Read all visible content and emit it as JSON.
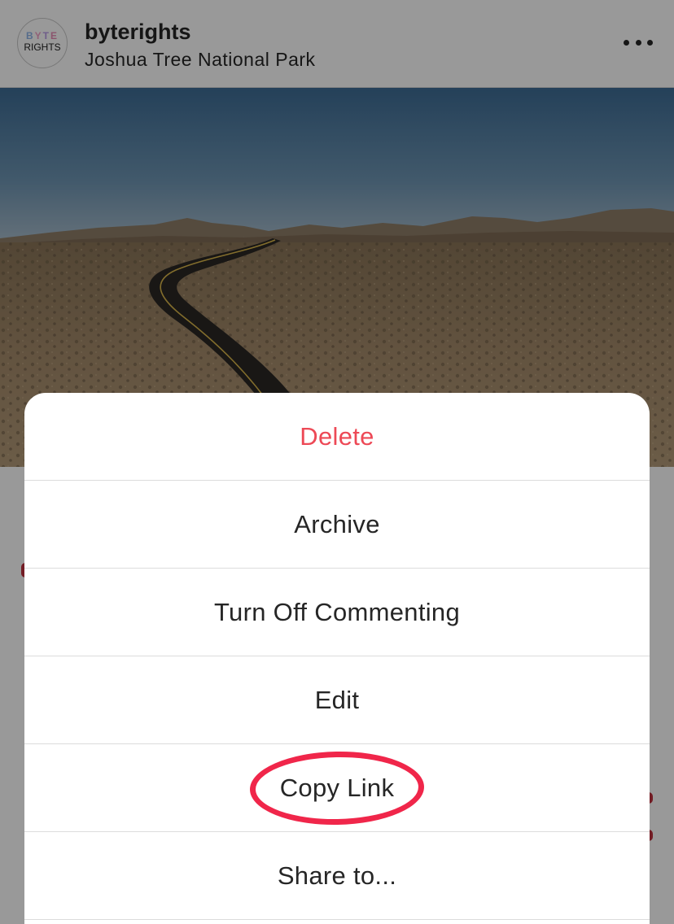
{
  "post": {
    "username": "byterights",
    "location": "Joshua Tree National Park",
    "avatar": {
      "top_text": "BYTE",
      "bottom_text": "RIGHTS"
    },
    "more_icon": "more-horizontal-icon"
  },
  "action_sheet": {
    "items": [
      {
        "label": "Delete",
        "destructive": true
      },
      {
        "label": "Archive",
        "destructive": false
      },
      {
        "label": "Turn Off Commenting",
        "destructive": false
      },
      {
        "label": "Edit",
        "destructive": false
      },
      {
        "label": "Copy Link",
        "destructive": false,
        "highlighted": true
      },
      {
        "label": "Share to...",
        "destructive": false
      }
    ]
  },
  "colors": {
    "destructive": "#ed4956",
    "highlight_ring": "#f0264a",
    "text": "#262626"
  }
}
